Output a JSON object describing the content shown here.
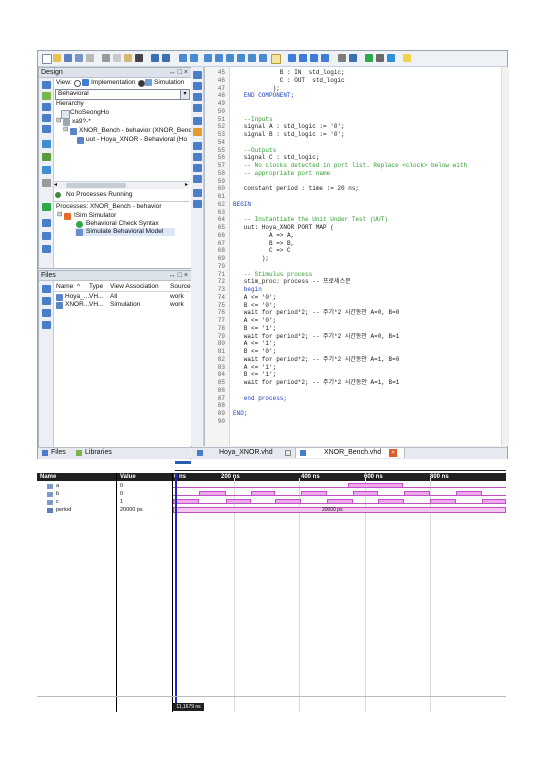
{
  "colors": {
    "accent": "#2a5db0",
    "wave_fill": "#f0a8ee",
    "wave_line": "#c050c8",
    "cursor": "#2222cc"
  },
  "design_panel": {
    "title": "Design",
    "controls": "↔ □ ×",
    "view_label": "View:",
    "view_implementation": "Implementation",
    "view_simulation": "Simulation",
    "dropdown_value": "Behavioral",
    "hierarchy_label": "Hierarchy",
    "tree": [
      "ChoSeongHo",
      "xa9?-*",
      "XNOR_Bench - behavior (XNOR_Bench.",
      "uut - Hoya_XNOR - Behavioral (Ho"
    ],
    "no_processes": "No Processes Running",
    "processes_label": "Processes: XNOR_Bench - behavior",
    "process_items": [
      "ISim Simulator",
      "Behavioral Check Syntax",
      "Simulate Behavioral Model"
    ]
  },
  "files_panel": {
    "title": "Files",
    "controls": "↔ □ ×",
    "columns": [
      "Name",
      "Type",
      "View Association",
      "Source"
    ],
    "rows": [
      {
        "name": "Hoya_...",
        "type": "VH...",
        "assoc": "All",
        "source": "work"
      },
      {
        "name": "XNOR...",
        "type": "VH...",
        "assoc": "Simulation",
        "source": "work"
      }
    ],
    "tab_files": "Files",
    "tab_libraries": "Libraries"
  },
  "editor": {
    "lines": [
      {
        "n": "45",
        "t": "             B : IN  std_logic;"
      },
      {
        "n": "46",
        "t": "             C : OUT  std_logic"
      },
      {
        "n": "47",
        "t": "           );"
      },
      {
        "n": "48",
        "t": "   END COMPONENT;"
      },
      {
        "n": "49",
        "t": ""
      },
      {
        "n": "50",
        "t": ""
      },
      {
        "n": "51",
        "t": "   --Inputs"
      },
      {
        "n": "52",
        "t": "   signal A : std_logic := '0';"
      },
      {
        "n": "53",
        "t": "   signal B : std_logic := '0';"
      },
      {
        "n": "54",
        "t": ""
      },
      {
        "n": "55",
        "t": "   --Outputs"
      },
      {
        "n": "56",
        "t": "   signal C : std_logic;"
      },
      {
        "n": "57",
        "t": "   -- No clocks detected in port list. Replace <clock> below with"
      },
      {
        "n": "58",
        "t": "   -- appropriate port name"
      },
      {
        "n": "59",
        "t": ""
      },
      {
        "n": "60",
        "t": "   constant period : time := 20 ns;"
      },
      {
        "n": "61",
        "t": ""
      },
      {
        "n": "62",
        "t": "BEGIN"
      },
      {
        "n": "63",
        "t": ""
      },
      {
        "n": "64",
        "t": "   -- Instantiate the Unit Under Test (UUT)"
      },
      {
        "n": "65",
        "t": "   uut: Hoya_XNOR PORT MAP ("
      },
      {
        "n": "66",
        "t": "          A => A,"
      },
      {
        "n": "67",
        "t": "          B => B,"
      },
      {
        "n": "68",
        "t": "          C => C"
      },
      {
        "n": "69",
        "t": "        );"
      },
      {
        "n": "70",
        "t": ""
      },
      {
        "n": "71",
        "t": "   -- Stimulus process"
      },
      {
        "n": "72",
        "t": "   stim_proc: process -- 프로세스문"
      },
      {
        "n": "73",
        "t": "   begin"
      },
      {
        "n": "74",
        "t": "   A <= '0';"
      },
      {
        "n": "75",
        "t": "   B <= '0';"
      },
      {
        "n": "76",
        "t": "   wait for period*2; -- 주기*2 시간동안 A=0, B=0"
      },
      {
        "n": "77",
        "t": "   A <= '0';"
      },
      {
        "n": "78",
        "t": "   B <= '1';"
      },
      {
        "n": "79",
        "t": "   wait for period*2; -- 주기*2 시간동안 A=0, B=1"
      },
      {
        "n": "80",
        "t": "   A <= '1';"
      },
      {
        "n": "81",
        "t": "   B <= '0';"
      },
      {
        "n": "82",
        "t": "   wait for period*2; -- 주기*2 시간동안 A=1, B=0"
      },
      {
        "n": "83",
        "t": "   A <= '1';"
      },
      {
        "n": "84",
        "t": "   B <= '1';"
      },
      {
        "n": "85",
        "t": "   wait for period*2; -- 주기*2 시간동안 A=1, B=1"
      },
      {
        "n": "86",
        "t": ""
      },
      {
        "n": "87",
        "t": "   end process;"
      },
      {
        "n": "88",
        "t": ""
      },
      {
        "n": "89",
        "t": "END;"
      },
      {
        "n": "90",
        "t": ""
      }
    ],
    "tab1": "Hoya_XNOR.vhd",
    "tab2": "XNOR_Bench.vhd"
  },
  "waveform": {
    "header_name": "Name",
    "header_value": "Value",
    "time_labels": [
      "0 ns",
      "200 ns",
      "400 ns",
      "600 ns",
      "800 ns"
    ],
    "signals": [
      {
        "name": "a",
        "value": "0"
      },
      {
        "name": "b",
        "value": "0"
      },
      {
        "name": "c",
        "value": "1"
      },
      {
        "name": "period",
        "value": "20000 ps"
      }
    ],
    "period_bus_value": "20000 ps",
    "cursor_time": "11,1679 ns"
  }
}
